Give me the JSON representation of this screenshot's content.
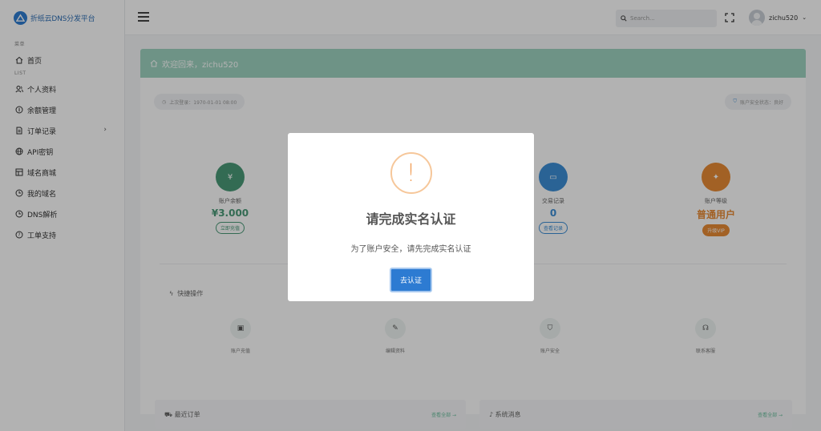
{
  "brand": {
    "name": "折纸云DNS分发平台"
  },
  "sidebar": {
    "section_menu": "菜单",
    "section_list": "LIST",
    "items": [
      {
        "label": "首页",
        "icon": "home-icon"
      },
      {
        "label": "个人资料",
        "icon": "users-icon"
      },
      {
        "label": "余额管理",
        "icon": "coin-icon"
      },
      {
        "label": "订单记录",
        "icon": "file-icon"
      },
      {
        "label": "API密钥",
        "icon": "globe-icon"
      },
      {
        "label": "域名商城",
        "icon": "grid-icon"
      },
      {
        "label": "我的域名",
        "icon": "clock-icon"
      },
      {
        "label": "DNS解析",
        "icon": "clock-icon"
      },
      {
        "label": "工单支持",
        "icon": "help-icon"
      }
    ]
  },
  "topbar": {
    "search_placeholder": "Search...",
    "username": "zichu520"
  },
  "main": {
    "welcome": "欢迎回来，zichu520",
    "last_login": "上次登录：1970-01-01 08:00",
    "security": "账户安全状态：良好",
    "stats": [
      {
        "label": "账户余额",
        "value": "¥3.000",
        "button": "立即充值",
        "color": "#4a9a78"
      },
      {
        "label": "交易记录",
        "value": "0",
        "button": "查看记录",
        "color": "#3d8fd6"
      },
      {
        "label": "账户等级",
        "value": "普通用户",
        "button": "升级VIP",
        "color": "#e88b35"
      }
    ],
    "quick_title": "快捷操作",
    "quick": [
      {
        "label": "账户充值"
      },
      {
        "label": "编辑资料"
      },
      {
        "label": "账户安全"
      },
      {
        "label": "联系客服"
      }
    ],
    "orders_title": "最近订单",
    "orders_more": "查看全部 →",
    "messages_title": "系统消息",
    "messages_more": "查看全部 →"
  },
  "modal": {
    "icon": "!",
    "title": "请完成实名认证",
    "text": "为了账户安全，请先完成实名认证",
    "button": "去认证"
  }
}
